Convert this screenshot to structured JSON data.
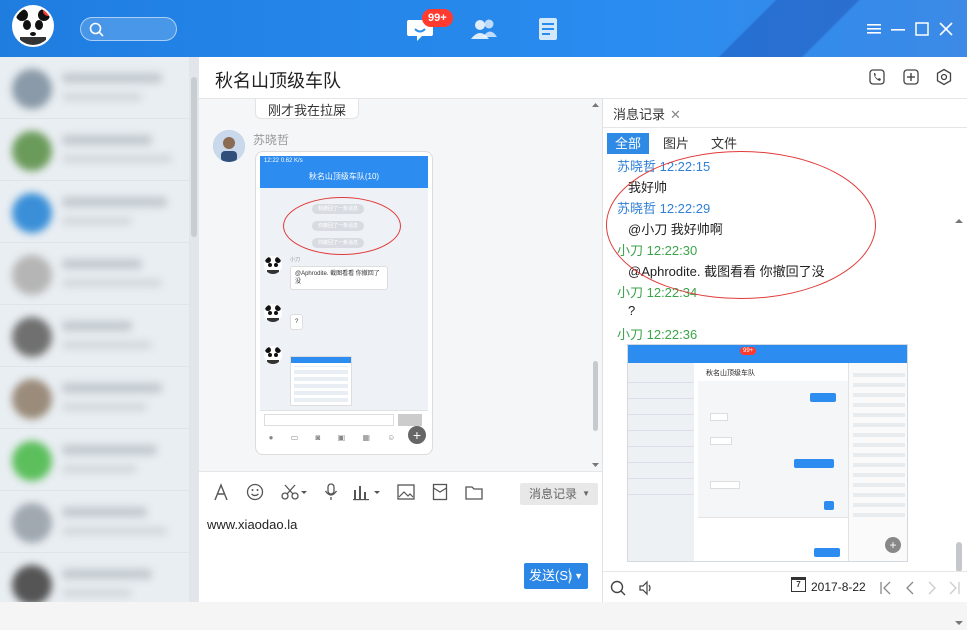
{
  "topbar": {
    "badge": "99+"
  },
  "header": {
    "title": "秋名山顶级车队"
  },
  "chat": {
    "prev_bubble": "刚才我在拉屎",
    "sender": "苏晓哲",
    "screenshot": {
      "status_time": "12:22",
      "status_right": "0.62 K/s",
      "title": "秋名山顶级车队(10)",
      "recall_1": "我撤回了一条消息",
      "recall_2": "你撤回了一条消息",
      "recall_3": "你撤回了一条消息",
      "sender_small": "小刀",
      "msg_1": "@Aphrodite. 截图看看 你撤回了没",
      "msg_2": "?"
    }
  },
  "toolbar": {
    "history_label": "消息记录"
  },
  "input": {
    "text": "www.xiaodao.la"
  },
  "send": {
    "label": "发送(S)"
  },
  "history": {
    "tab_label": "消息记录",
    "filters": [
      "全部",
      "图片",
      "文件"
    ],
    "messages": [
      {
        "head": "苏晓哲 12:22:15",
        "body": "我好帅"
      },
      {
        "head": "苏晓哲 12:22:29",
        "body": "@小刀 我好帅啊"
      },
      {
        "head": "小刀 12:22:30",
        "body": "@Aphrodite. 截图看看 你撤回了没"
      },
      {
        "head": "小刀 12:22:34",
        "body": "?"
      },
      {
        "head": "小刀 12:22:36",
        "body": ""
      }
    ],
    "thumb": {
      "title": "秋名山顶级车队",
      "badge": "99+"
    },
    "calendar_day": "7",
    "date": "2017-8-22"
  },
  "colors": {
    "accent": "#2b86e6",
    "annotation": "#e23a3a",
    "green_name": "#3ba34a",
    "blue_name": "#2f80d6"
  }
}
